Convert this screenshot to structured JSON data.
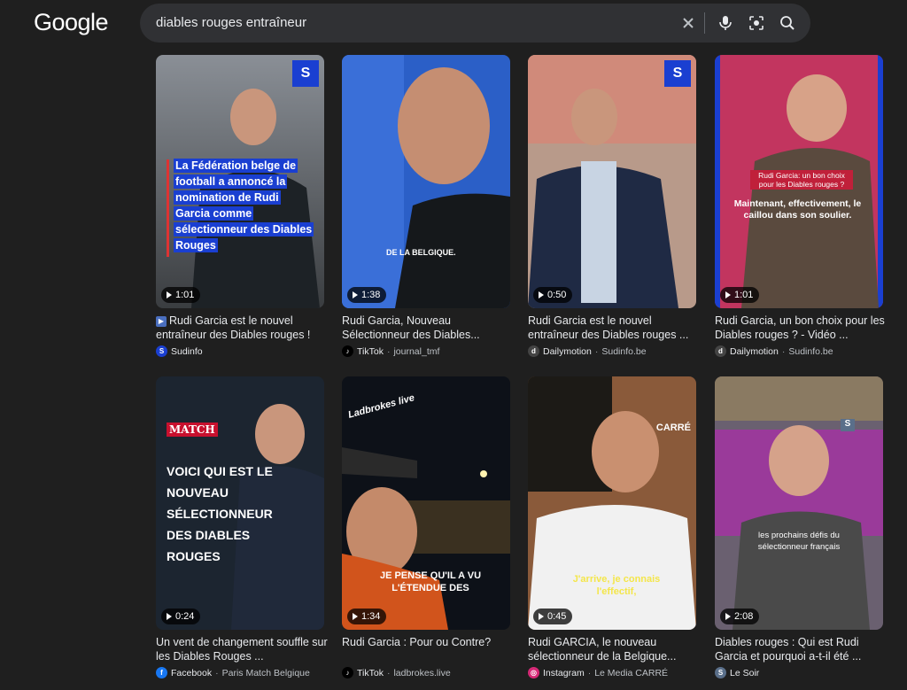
{
  "logo": "Google",
  "search": {
    "query": "diables rouges entraîneur"
  },
  "icons": {
    "clear": "close-icon",
    "voice": "microphone-icon",
    "lens": "camera-lens-icon",
    "search": "search-icon"
  },
  "results": [
    {
      "duration": "1:01",
      "title": "Rudi Garcia est le nouvel entraîneur des Diables rouges !",
      "title_prefix": "▶",
      "platform": "Sudinfo",
      "source": "",
      "overlay": "La Fédération belge de football a annoncé la nomination de Rudi Garcia comme sélectionneur des Diables Rouges",
      "badge": "S"
    },
    {
      "duration": "1:38",
      "title": "Rudi Garcia, Nouveau Sélectionneur des Diables...",
      "platform": "TikTok",
      "source": "journal_tmf",
      "overlay": "DE LA BELGIQUE."
    },
    {
      "duration": "0:50",
      "title": "Rudi Garcia est le nouvel entraîneur des Diables rouges ...",
      "platform": "Dailymotion",
      "source": "Sudinfo.be",
      "badge": "S"
    },
    {
      "duration": "1:01",
      "title": "Rudi Garcia, un bon choix pour les Diables rouges ? - Vidéo ...",
      "platform": "Dailymotion",
      "source": "Sudinfo.be",
      "overlay_small": "Rudi Garcia: un bon choix pour les Diables rouges ?",
      "overlay": "Maintenant, effectivement, le caillou dans son soulier."
    },
    {
      "duration": "0:24",
      "title": "Un vent de changement souffle sur les Diables Rouges ...",
      "platform": "Facebook",
      "source": "Paris Match Belgique",
      "brand": "MATCH",
      "overlay": "VOICI QUI EST LE NOUVEAU SÉLECTIONNEUR DES DIABLES ROUGES"
    },
    {
      "duration": "1:34",
      "title": "Rudi Garcia : Pour ou Contre?",
      "platform": "TikTok",
      "source": "ladbrokes.live",
      "brand": "Ladbrokes live",
      "overlay": "JE PENSE QU'IL A VU L'ÉTENDUE DES"
    },
    {
      "duration": "0:45",
      "title": "Rudi GARCIA, le nouveau sélectionneur de la Belgique...",
      "platform": "Instagram",
      "source": "Le Media CARRÉ",
      "brand": "CARRÉ",
      "overlay": "J'arrive, je connais l'effectif,"
    },
    {
      "duration": "2:08",
      "title": "Diables rouges : Qui est Rudi Garcia et pourquoi a-t-il été ...",
      "platform": "Le Soir",
      "source": "",
      "brand": "S",
      "overlay": "les prochains défis du sélectionneur français"
    }
  ],
  "colors": {
    "background": "#1f1f1f",
    "searchbar": "#303134",
    "text": "#e8eaed",
    "muted": "#bdc1c6",
    "badge_blue": "#1a3fd1"
  }
}
